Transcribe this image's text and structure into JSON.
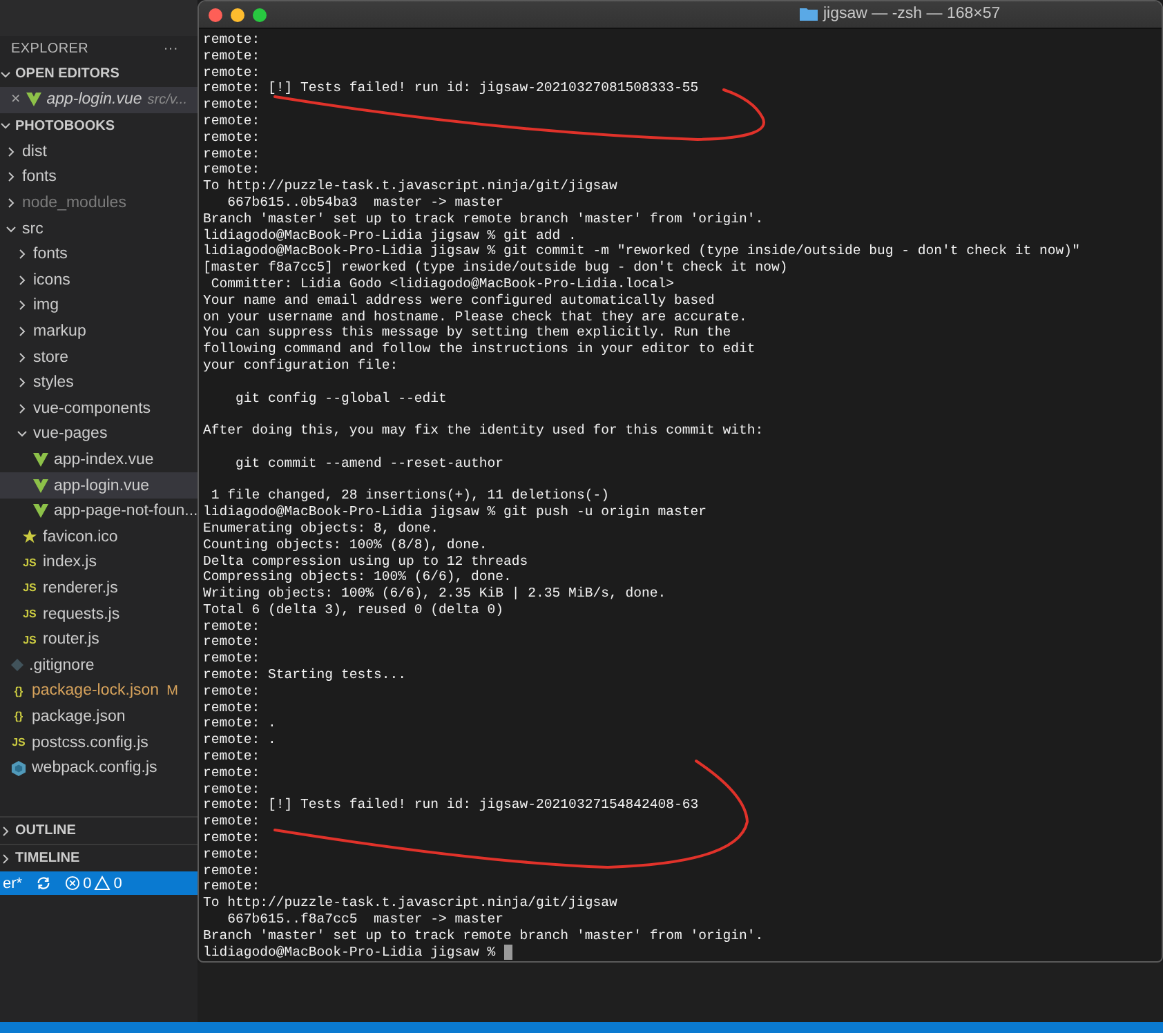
{
  "explorer": {
    "title": "EXPLORER",
    "more": "···",
    "open_editors": {
      "title": "OPEN EDITORS",
      "expanded": true,
      "items": [
        {
          "name": "app-login.vue",
          "path": "src/v...",
          "kind": "vue",
          "close": "×",
          "selected": true
        }
      ]
    },
    "project": {
      "title": "PHOTOBOOKS",
      "expanded": true,
      "tree": [
        {
          "name": "dist",
          "kind": "folder",
          "expanded": false,
          "selected": false,
          "dimmed": false,
          "modified": false
        },
        {
          "name": "fonts",
          "kind": "folder",
          "expanded": false,
          "selected": false,
          "dimmed": false,
          "modified": false
        },
        {
          "name": "node_modules",
          "kind": "folder",
          "expanded": false,
          "selected": false,
          "dimmed": true,
          "modified": false
        },
        {
          "name": "src",
          "kind": "folder",
          "expanded": true,
          "selected": false,
          "dimmed": false,
          "modified": false,
          "children": [
            {
              "name": "fonts",
              "kind": "folder",
              "expanded": false,
              "selected": false,
              "dimmed": false,
              "modified": false
            },
            {
              "name": "icons",
              "kind": "folder",
              "expanded": false,
              "selected": false,
              "dimmed": false,
              "modified": false
            },
            {
              "name": "img",
              "kind": "folder",
              "expanded": false,
              "selected": false,
              "dimmed": false,
              "modified": false
            },
            {
              "name": "markup",
              "kind": "folder",
              "expanded": false,
              "selected": false,
              "dimmed": false,
              "modified": false
            },
            {
              "name": "store",
              "kind": "folder",
              "expanded": false,
              "selected": false,
              "dimmed": false,
              "modified": false
            },
            {
              "name": "styles",
              "kind": "folder",
              "expanded": false,
              "selected": false,
              "dimmed": false,
              "modified": false
            },
            {
              "name": "vue-components",
              "kind": "folder",
              "expanded": false,
              "selected": false,
              "dimmed": false,
              "modified": false
            },
            {
              "name": "vue-pages",
              "kind": "folder",
              "expanded": true,
              "selected": false,
              "dimmed": false,
              "modified": false,
              "children": [
                {
                  "name": "app-index.vue",
                  "kind": "vue",
                  "selected": false,
                  "dimmed": false,
                  "modified": false
                },
                {
                  "name": "app-login.vue",
                  "kind": "vue",
                  "selected": true,
                  "dimmed": false,
                  "modified": false
                },
                {
                  "name": "app-page-not-foun...",
                  "kind": "vue",
                  "selected": false,
                  "dimmed": false,
                  "modified": false
                }
              ]
            },
            {
              "name": "favicon.ico",
              "kind": "star",
              "selected": false,
              "dimmed": false,
              "modified": false
            },
            {
              "name": "index.js",
              "kind": "js",
              "icon_label": "JS",
              "selected": false,
              "dimmed": false,
              "modified": false
            },
            {
              "name": "renderer.js",
              "kind": "js",
              "icon_label": "JS",
              "selected": false,
              "dimmed": false,
              "modified": false
            },
            {
              "name": "requests.js",
              "kind": "js",
              "icon_label": "JS",
              "selected": false,
              "dimmed": false,
              "modified": false
            },
            {
              "name": "router.js",
              "kind": "js",
              "icon_label": "JS",
              "selected": false,
              "dimmed": false,
              "modified": false
            }
          ]
        },
        {
          "name": ".gitignore",
          "kind": "git",
          "selected": false,
          "dimmed": false,
          "modified": false
        },
        {
          "name": "package-lock.json",
          "kind": "json",
          "icon_label": "{}",
          "selected": false,
          "dimmed": false,
          "modified": true,
          "badge": "M"
        },
        {
          "name": "package.json",
          "kind": "json",
          "icon_label": "{}",
          "selected": false,
          "dimmed": false,
          "modified": false
        },
        {
          "name": "postcss.config.js",
          "kind": "js",
          "icon_label": "JS",
          "selected": false,
          "dimmed": false,
          "modified": false
        },
        {
          "name": "webpack.config.js",
          "kind": "webpack",
          "selected": false,
          "dimmed": false,
          "modified": false
        }
      ]
    },
    "sections": [
      {
        "title": "OUTLINE",
        "expanded": false
      },
      {
        "title": "TIMELINE",
        "expanded": false
      }
    ]
  },
  "status_bar": {
    "branch": "er*",
    "errors": "0",
    "warnings": "0"
  },
  "terminal": {
    "title": "jigsaw — -zsh — 168×57",
    "lines": [
      {
        "kind": "text",
        "text": "remote:"
      },
      {
        "kind": "text",
        "text": "remote:"
      },
      {
        "kind": "text",
        "text": "remote:"
      },
      {
        "kind": "text",
        "text": "remote: [!] Tests failed! run id: jigsaw-20210327081508333-55"
      },
      {
        "kind": "text",
        "text": "remote:"
      },
      {
        "kind": "text",
        "text": "remote:"
      },
      {
        "kind": "text",
        "text": "remote:"
      },
      {
        "kind": "text",
        "text": "remote:"
      },
      {
        "kind": "text",
        "text": "remote:"
      },
      {
        "kind": "text",
        "text": "To http://puzzle-task.t.javascript.ninja/git/jigsaw"
      },
      {
        "kind": "text",
        "text": "   667b615..0b54ba3  master -> master"
      },
      {
        "kind": "text",
        "text": "Branch 'master' set up to track remote branch 'master' from 'origin'."
      },
      {
        "kind": "text",
        "text": "lidiagodo@MacBook-Pro-Lidia jigsaw % git add ."
      },
      {
        "kind": "text",
        "text": "lidiagodo@MacBook-Pro-Lidia jigsaw % git commit -m \"reworked (type inside/outside bug - don't check it now)\""
      },
      {
        "kind": "text",
        "text": "[master f8a7cc5] reworked (type inside/outside bug - don't check it now)"
      },
      {
        "kind": "text",
        "text": " Committer: Lidia Godo <lidiagodo@MacBook-Pro-Lidia.local>"
      },
      {
        "kind": "text",
        "text": "Your name and email address were configured automatically based"
      },
      {
        "kind": "text",
        "text": "on your username and hostname. Please check that they are accurate."
      },
      {
        "kind": "text",
        "text": "You can suppress this message by setting them explicitly. Run the"
      },
      {
        "kind": "text",
        "text": "following command and follow the instructions in your editor to edit"
      },
      {
        "kind": "text",
        "text": "your configuration file:"
      },
      {
        "kind": "blank"
      },
      {
        "kind": "text",
        "text": "    git config --global --edit"
      },
      {
        "kind": "blank"
      },
      {
        "kind": "text",
        "text": "After doing this, you may fix the identity used for this commit with:"
      },
      {
        "kind": "blank"
      },
      {
        "kind": "text",
        "text": "    git commit --amend --reset-author"
      },
      {
        "kind": "blank"
      },
      {
        "kind": "text",
        "text": " 1 file changed, 28 insertions(+), 11 deletions(-)"
      },
      {
        "kind": "text",
        "text": "lidiagodo@MacBook-Pro-Lidia jigsaw % git push -u origin master"
      },
      {
        "kind": "text",
        "text": "Enumerating objects: 8, done."
      },
      {
        "kind": "text",
        "text": "Counting objects: 100% (8/8), done."
      },
      {
        "kind": "text",
        "text": "Delta compression using up to 12 threads"
      },
      {
        "kind": "text",
        "text": "Compressing objects: 100% (6/6), done."
      },
      {
        "kind": "text",
        "text": "Writing objects: 100% (6/6), 2.35 KiB | 2.35 MiB/s, done."
      },
      {
        "kind": "text",
        "text": "Total 6 (delta 3), reused 0 (delta 0)"
      },
      {
        "kind": "text",
        "text": "remote:"
      },
      {
        "kind": "text",
        "text": "remote:"
      },
      {
        "kind": "text",
        "text": "remote:"
      },
      {
        "kind": "text",
        "text": "remote: Starting tests..."
      },
      {
        "kind": "text",
        "text": "remote:"
      },
      {
        "kind": "text",
        "text": "remote:"
      },
      {
        "kind": "text",
        "text": "remote: ."
      },
      {
        "kind": "text",
        "text": "remote: ."
      },
      {
        "kind": "text",
        "text": "remote:"
      },
      {
        "kind": "text",
        "text": "remote:"
      },
      {
        "kind": "text",
        "text": "remote:"
      },
      {
        "kind": "text",
        "text": "remote: [!] Tests failed! run id: jigsaw-20210327154842408-63"
      },
      {
        "kind": "text",
        "text": "remote:"
      },
      {
        "kind": "text",
        "text": "remote:"
      },
      {
        "kind": "text",
        "text": "remote:"
      },
      {
        "kind": "text",
        "text": "remote:"
      },
      {
        "kind": "text",
        "text": "remote:"
      },
      {
        "kind": "text",
        "text": "To http://puzzle-task.t.javascript.ninja/git/jigsaw"
      },
      {
        "kind": "text",
        "text": "   667b615..f8a7cc5  master -> master"
      },
      {
        "kind": "text",
        "text": "Branch 'master' set up to track remote branch 'master' from 'origin'."
      },
      {
        "kind": "prompt",
        "text": "lidiagodo@MacBook-Pro-Lidia jigsaw % "
      }
    ]
  }
}
